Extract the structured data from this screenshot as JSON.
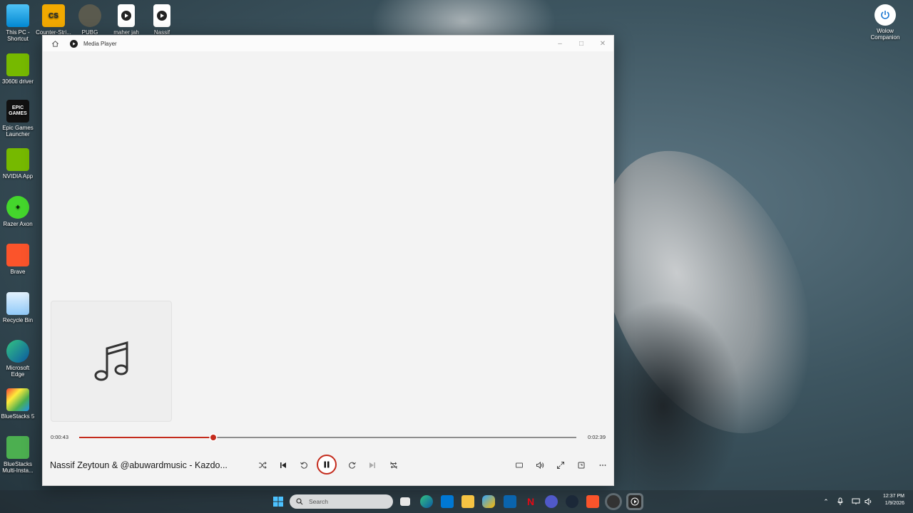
{
  "desktop": {
    "icons": [
      {
        "label": "This PC - Shortcut",
        "icon": "this-pc-icon"
      },
      {
        "label": "Counter-Stri...",
        "icon": "counter-strike-icon"
      },
      {
        "label": "PUBG",
        "icon": "pubg-icon"
      },
      {
        "label": "maher jah",
        "icon": "media-file-icon"
      },
      {
        "label": "Nassif",
        "icon": "media-file-icon"
      },
      {
        "label": "3060ti driver",
        "icon": "nvidia-icon"
      },
      {
        "label": "Epic Games Launcher",
        "icon": "epic-games-icon"
      },
      {
        "label": "NVIDIA App",
        "icon": "nvidia-icon"
      },
      {
        "label": "Razer Axon",
        "icon": "razer-axon-icon"
      },
      {
        "label": "Brave",
        "icon": "brave-icon"
      },
      {
        "label": "Recycle Bin",
        "icon": "recycle-bin-icon"
      },
      {
        "label": "Microsoft Edge",
        "icon": "edge-icon"
      },
      {
        "label": "BlueStacks 5",
        "icon": "bluestacks-icon"
      },
      {
        "label": "BlueStacks Multi-Insta...",
        "icon": "bluestacks-multi-icon"
      },
      {
        "label": "Wolow Companion",
        "icon": "power-icon"
      }
    ],
    "epic_logo_text": "EPIC GAMES"
  },
  "player": {
    "app_title": "Media Player",
    "current_time": "0:00:43",
    "total_time": "0:02:39",
    "progress_fraction": 0.2704,
    "now_playing": "Nassif Zeytoun & @abuwardmusic - Kazdo...",
    "accent_color": "#c42b1c"
  },
  "taskbar": {
    "search_placeholder": "Search",
    "clock_time": "12:37 PM",
    "clock_date": "1/9/2026"
  }
}
